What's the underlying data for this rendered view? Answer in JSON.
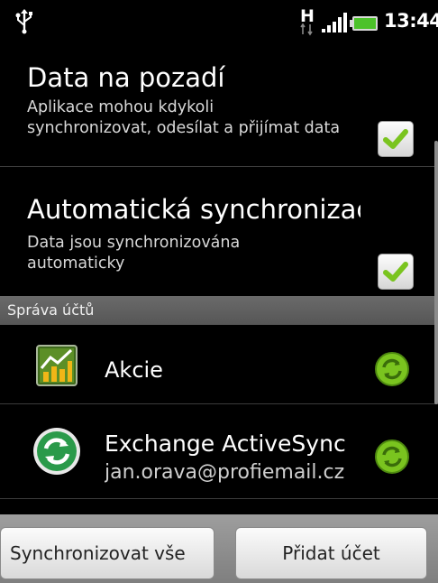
{
  "status_bar": {
    "time": "13:44",
    "network_type": "H",
    "icons": [
      "usb-icon",
      "hspa-icon",
      "signal-icon",
      "battery-icon"
    ]
  },
  "settings": {
    "background_data": {
      "title": "Data na pozadí",
      "summary": "Aplikace mohou kdykoli synchronizovat, odesílat a přijímat data",
      "checked": true
    },
    "auto_sync": {
      "title": "Automatická synchronizace",
      "summary": "Data jsou synchronizována automaticky",
      "checked": true
    }
  },
  "accounts_section": {
    "header": "Správa účtů",
    "accounts": [
      {
        "name": "Akcie",
        "icon": "stocks-icon",
        "status_icon": "sync-icon"
      },
      {
        "name": "Exchange ActiveSync",
        "email": "jan.orava@profiemail.cz",
        "icon": "exchange-activesync-icon",
        "status_icon": "sync-icon"
      }
    ]
  },
  "buttons": {
    "sync": "Synchronizovat vše",
    "add_account": "Přidat účet"
  },
  "colors": {
    "accent_green": "#7ac41f",
    "background": "#000000",
    "section_header": "#606060"
  }
}
